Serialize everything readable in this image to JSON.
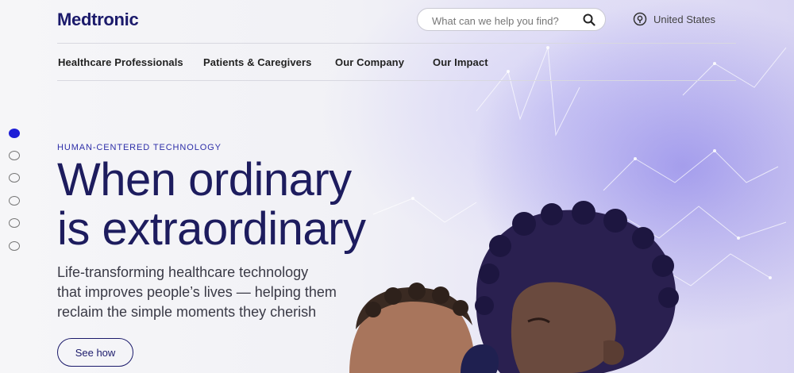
{
  "brand": {
    "logo_text": "Medtronic",
    "color": "#1b1a6b"
  },
  "search": {
    "placeholder": "What can we help you find?",
    "icon": "search-icon"
  },
  "region": {
    "label": "United States",
    "icon": "location-pin-icon"
  },
  "nav": {
    "items": [
      {
        "label": "Healthcare Professionals"
      },
      {
        "label": "Patients & Caregivers"
      },
      {
        "label": "Our Company"
      },
      {
        "label": "Our Impact"
      }
    ]
  },
  "carousel": {
    "slide_count": 6,
    "active_index": 0,
    "active_color": "#1f1fd6"
  },
  "hero": {
    "eyebrow": "HUMAN-CENTERED TECHNOLOGY",
    "headline_line1": "When ordinary",
    "headline_line2": "is extraordinary",
    "sub_line1": "Life-transforming healthcare technology",
    "sub_line2": "that improves people’s lives — helping them",
    "sub_line3": "reclaim the simple moments they cherish",
    "cta_label": "See how"
  }
}
